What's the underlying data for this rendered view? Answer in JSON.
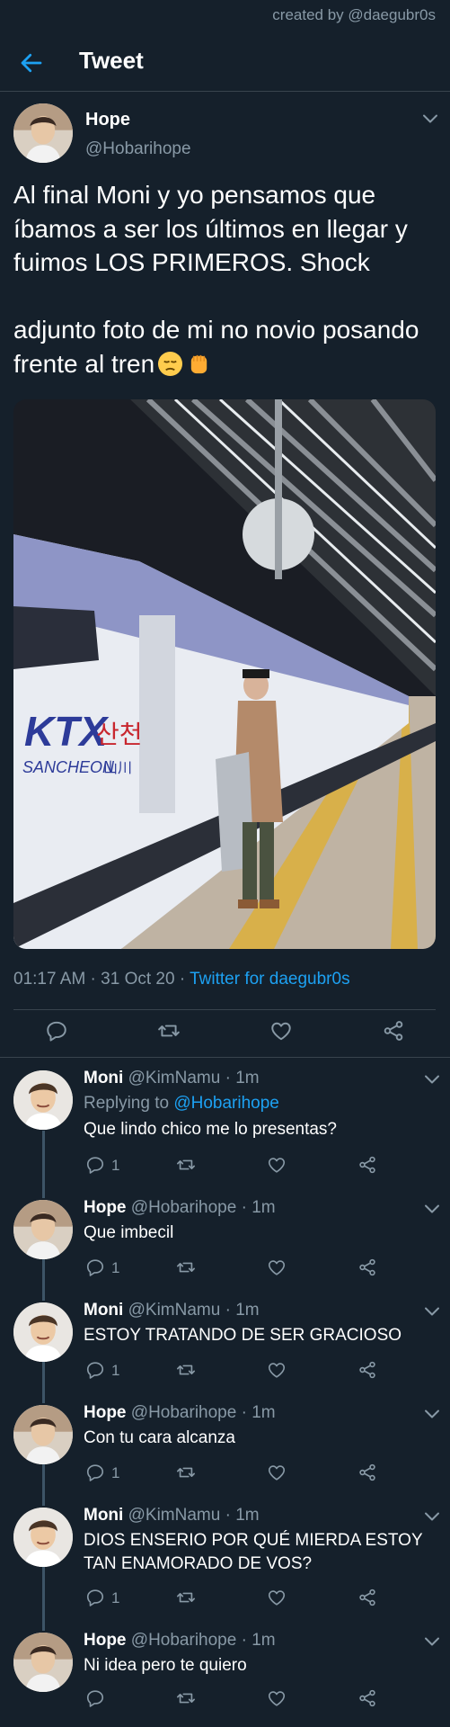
{
  "credit": "created by @daegubr0s",
  "header": {
    "title": "Tweet"
  },
  "tweet": {
    "name": "Hope",
    "handle": "@Hobarihope",
    "text": "Al final Moni y yo pensamos que íbamos a ser los últimos en llegar y fuimos LOS PRIMEROS. Shock\n\nadjunto foto de mi no novio posando frente al tren",
    "emojis": [
      "pensive-face",
      "raised-fist"
    ],
    "photo_text": {
      "brand": "KTX",
      "korean": "산천",
      "line": "SANCHEON",
      "korean_small": "山川"
    },
    "time": "01:17 AM · 31 Oct 20 · ",
    "source": "Twitter for daegubr0s"
  },
  "replies": [
    {
      "name": "Moni",
      "handle": "@KimNamu",
      "time": "· 1m",
      "replying_prefix": "Replying to ",
      "replying_to": "@Hobarihope",
      "text": "Que lindo chico me lo presentas?",
      "reply_count": "1"
    },
    {
      "name": "Hope",
      "handle": "@Hobarihope",
      "time": "· 1m",
      "text": "Que imbecil",
      "reply_count": "1"
    },
    {
      "name": "Moni",
      "handle": "@KimNamu",
      "time": "· 1m",
      "text": "ESTOY TRATANDO DE SER GRACIOSO",
      "reply_count": "1"
    },
    {
      "name": "Hope",
      "handle": "@Hobarihope",
      "time": "· 1m",
      "text": "Con tu cara alcanza",
      "reply_count": "1"
    },
    {
      "name": "Moni",
      "handle": "@KimNamu",
      "time": "· 1m",
      "text": "DIOS ENSERIO POR QUÉ MIERDA ESTOY TAN ENAMORADO DE VOS?",
      "reply_count": "1"
    },
    {
      "name": "Hope",
      "handle": "@Hobarihope",
      "time": "· 1m",
      "text": "Ni idea pero te quiero",
      "reply_count": ""
    }
  ],
  "colors": {
    "background": "#15202b",
    "accent": "#1da1f2",
    "secondary_text": "#8899a6",
    "divider": "#38444d"
  },
  "icons": [
    "back-arrow-icon",
    "chevron-down-icon",
    "reply-icon",
    "retweet-icon",
    "like-icon",
    "share-icon"
  ]
}
